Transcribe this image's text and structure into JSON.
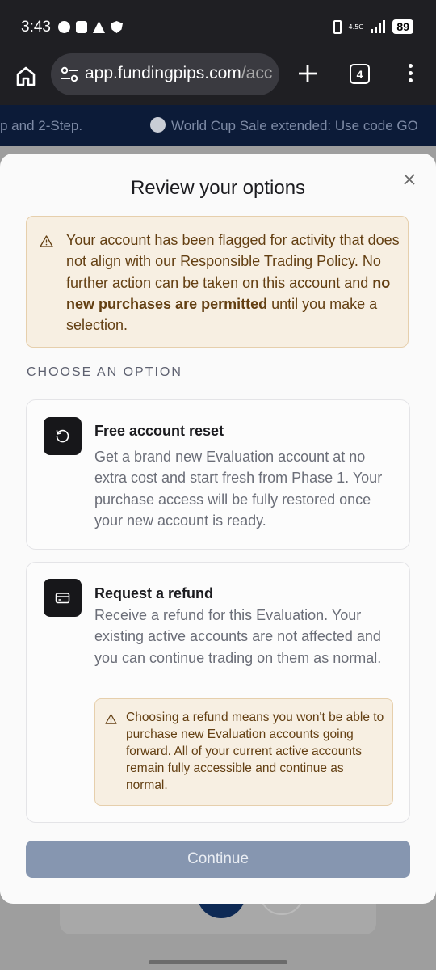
{
  "status_bar": {
    "time": "3:43",
    "network": "4.5G",
    "battery": "89"
  },
  "browser": {
    "url_domain": "app.fundingpips.com",
    "url_path": "/acc",
    "tab_count": "4"
  },
  "promo": {
    "text_left": "p and 2-Step.",
    "text_right": "World Cup Sale extended: Use code GO"
  },
  "modal": {
    "title": "Review your options",
    "warning_part1": "Your account has been flagged for activity that does not align with our Responsible Trading Policy. No further action can be taken on this account and ",
    "warning_bold": "no new purchases are permitted",
    "warning_part2": " until you make a selection.",
    "section_label": "CHOOSE AN OPTION",
    "options": [
      {
        "icon": "reset-icon",
        "title": "Free account reset",
        "description": "Get a brand new Evaluation account at no extra cost and start fresh from Phase 1. Your purchase access will be fully restored once your new account is ready."
      },
      {
        "icon": "card-icon",
        "title": "Request a refund",
        "description": "Receive a refund for this Evaluation. Your existing active accounts are not affected and you can continue trading on them as normal.",
        "warning": "Choosing a refund means you won't be able to purchase new Evaluation accounts going forward. All of your current active accounts remain fully accessible and continue as normal."
      }
    ],
    "continue_label": "Continue"
  },
  "colors": {
    "warning_bg": "#f7efe2",
    "warning_text": "#633f12",
    "continue_disabled": "#8696b0",
    "icon_tile": "#17171a"
  }
}
